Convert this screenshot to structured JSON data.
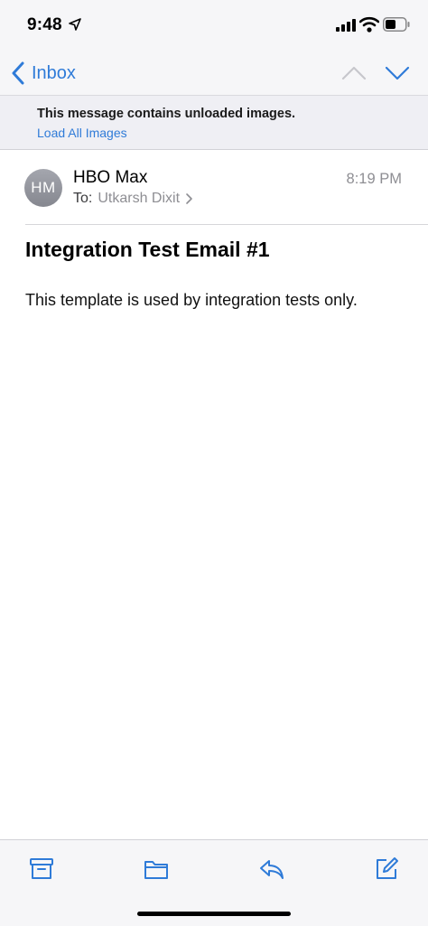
{
  "status_bar": {
    "time": "9:48"
  },
  "nav": {
    "back_label": "Inbox"
  },
  "banner": {
    "message": "This message contains unloaded images.",
    "link": "Load All Images"
  },
  "email": {
    "avatar_initials": "HM",
    "sender": "HBO Max",
    "time": "8:19 PM",
    "to_label": "To:",
    "recipient": "Utkarsh Dixit",
    "subject": "Integration Test Email #1",
    "body": "This template is used by integration tests only."
  },
  "colors": {
    "accent": "#2f7bd8",
    "secondary_text": "#8e8e93",
    "bar_background": "#f6f6f8"
  },
  "toolbar": {
    "icons": [
      "archive-icon",
      "folder-icon",
      "reply-icon",
      "compose-icon"
    ]
  }
}
